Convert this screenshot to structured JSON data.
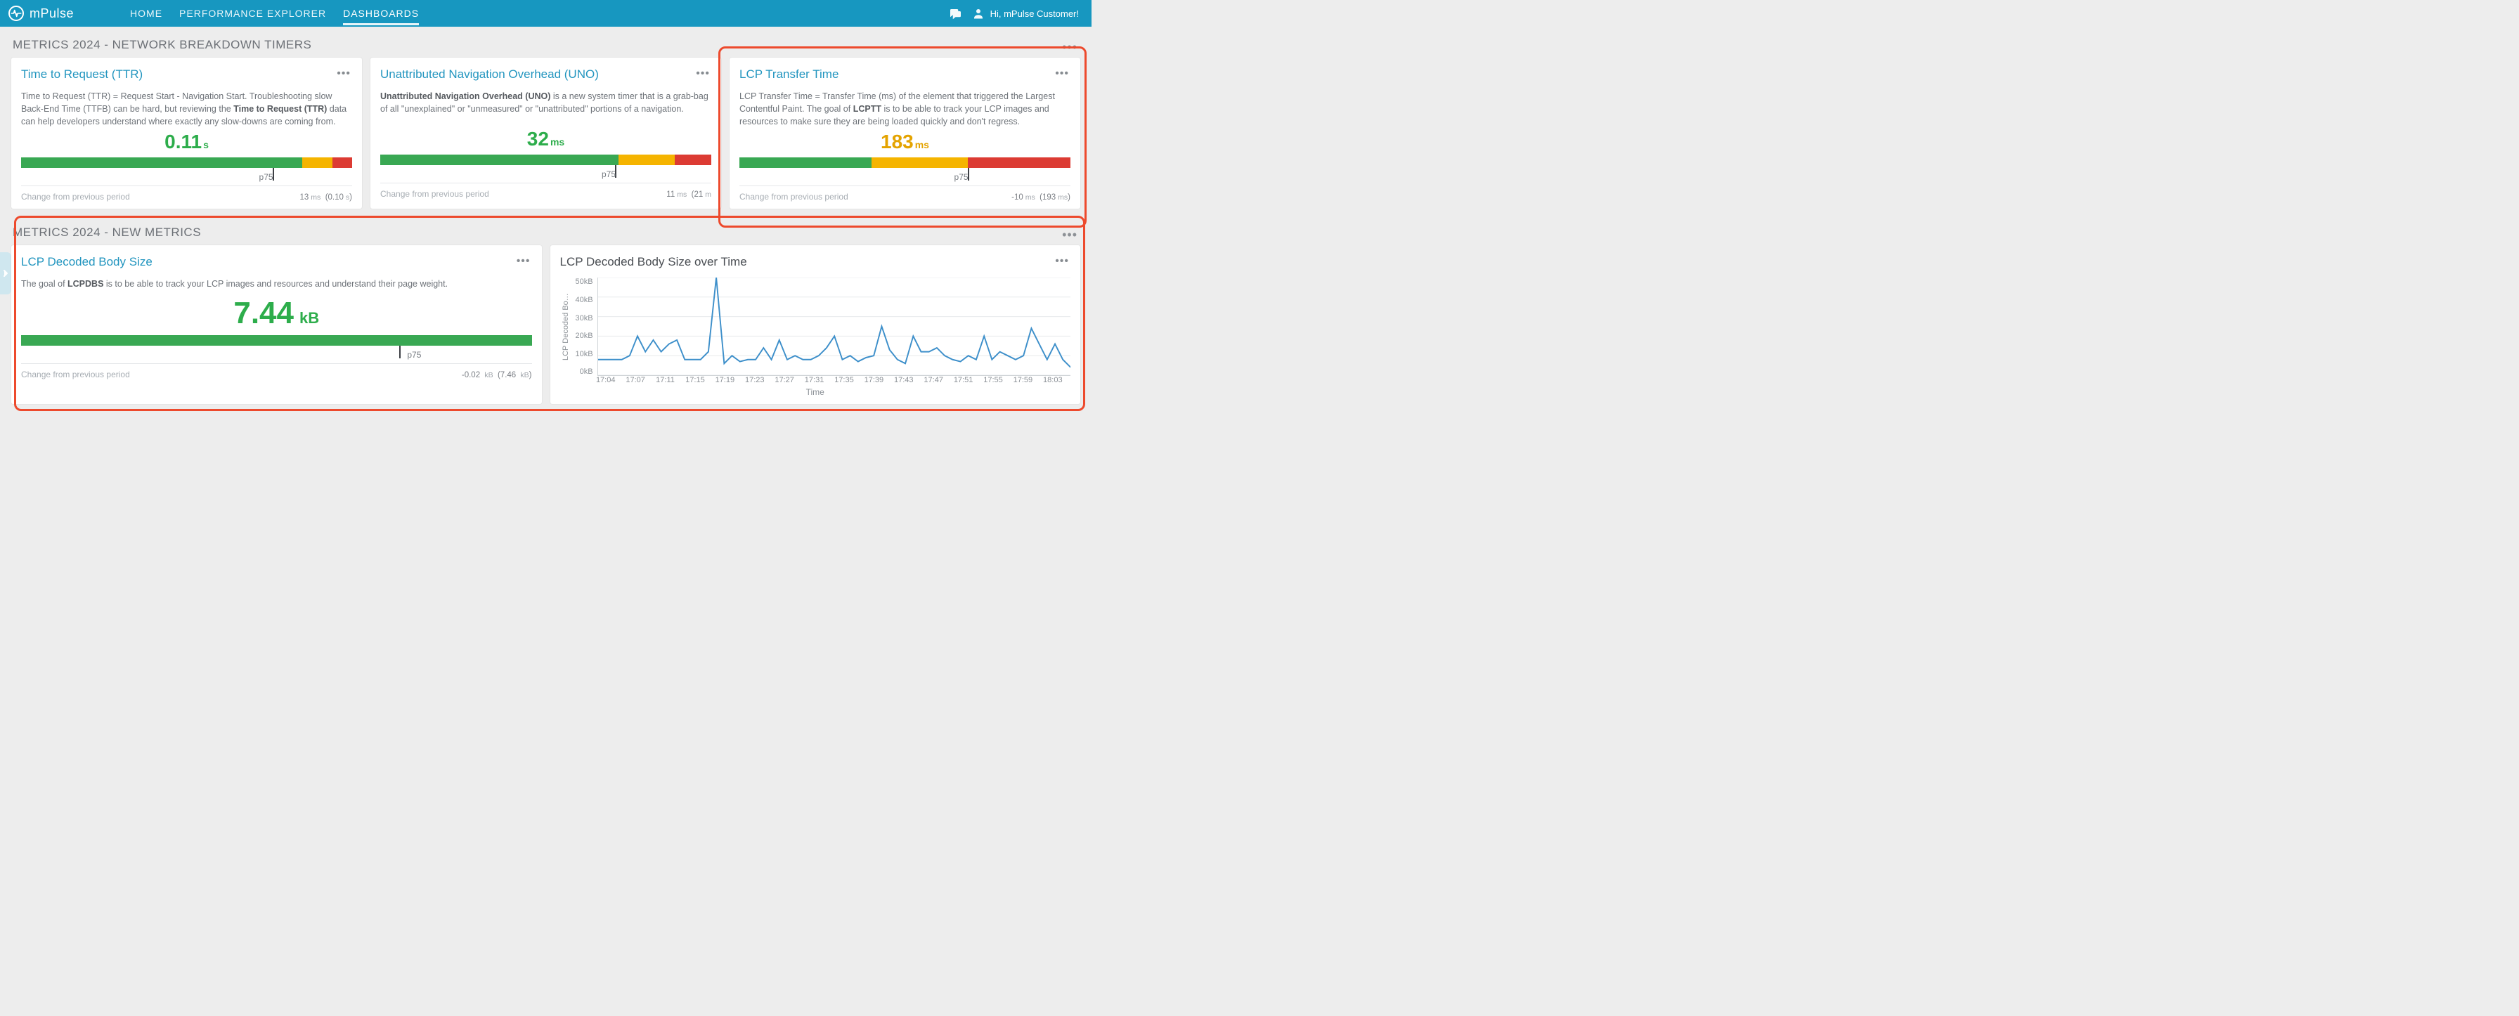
{
  "header": {
    "app_name": "mPulse",
    "nav": {
      "home": "HOME",
      "perf": "PERFORMANCE EXPLORER",
      "dash": "DASHBOARDS"
    },
    "greeting": "Hi, mPulse Customer!"
  },
  "section1": {
    "title": "METRICS 2024 - NETWORK BREAKDOWN TIMERS",
    "cards": [
      {
        "title": "Time to Request (TTR)",
        "desc_prefix": "Time to Request (TTR) = Request Start - Navigation Start. Troubleshooting slow Back-End Time (TTFB) can be hard, but reviewing the ",
        "desc_bold": "Time to Request (TTR)",
        "desc_suffix": " data can help developers understand where exactly any slow-downs are coming from.",
        "value": "0.11",
        "unit": "s",
        "tone": "green",
        "bar": {
          "g": 85,
          "a": 9,
          "r": 6
        },
        "p75_mark_pct": 76,
        "p75_label_pct": 74,
        "p75_label": "p75",
        "change_label": "Change from previous period",
        "change_value": "13",
        "change_unit": "ms",
        "change_extra": "(0.10",
        "change_extra_unit": "s",
        "change_close": ")"
      },
      {
        "title": "Unattributed Navigation Overhead (UNO)",
        "desc_bold": "Unattributed Navigation Overhead (UNO)",
        "desc_suffix": " is a new system timer that is a grab-bag of all \"unexplained\" or \"unmeasured\" or \"unattributed\" portions of a navigation.",
        "value": "32",
        "unit": "ms",
        "tone": "green",
        "bar": {
          "g": 72,
          "a": 17,
          "r": 11
        },
        "p75_mark_pct": 71,
        "p75_label_pct": 69,
        "p75_label": "p75",
        "change_label": "Change from previous period",
        "change_value": "11",
        "change_unit": "ms",
        "change_extra": "(21",
        "change_extra_unit": "m",
        "change_close": ""
      },
      {
        "title": "LCP Transfer Time",
        "desc_prefix": "LCP Transfer Time = Transfer Time (ms) of the element that triggered the Largest Contentful Paint. The goal of ",
        "desc_bold": "LCPTT",
        "desc_suffix": " is to be able to track your LCP images and resources to make sure they are being loaded quickly and don't regress.",
        "value": "183",
        "unit": "ms",
        "tone": "amber",
        "bar": {
          "g": 40,
          "a": 29,
          "r": 31
        },
        "p75_mark_pct": 69,
        "p75_label_pct": 67,
        "p75_label": "p75",
        "change_label": "Change from previous period",
        "change_value": "-10",
        "change_unit": "ms",
        "change_extra": "(193",
        "change_extra_unit": "ms",
        "change_close": ")"
      }
    ]
  },
  "section2": {
    "title": "METRICS 2024 - NEW METRICS",
    "card_left": {
      "title": "LCP Decoded Body Size",
      "desc_prefix": "The goal of ",
      "desc_bold": "LCPDBS",
      "desc_suffix": " is to be able to track your LCP images and resources and understand their page weight.",
      "value": "7.44",
      "unit": "kB",
      "p75_mark_pct": 74,
      "p75_label_pct": 77,
      "p75_label": "p75",
      "change_label": "Change from previous period",
      "change_value": "-0.02",
      "change_unit": "kB",
      "change_extra": "(7.46",
      "change_extra_unit": "kB",
      "change_close": ")"
    },
    "card_right": {
      "title": "LCP Decoded Body Size over Time",
      "ylabel": "LCP Decoded Bo…",
      "xlabel": "Time"
    }
  },
  "chart_data": {
    "type": "line",
    "title": "LCP Decoded Body Size over Time",
    "xlabel": "Time",
    "ylabel": "LCP Decoded Body Size",
    "ylim": [
      0,
      50
    ],
    "y_ticks": [
      "50kB",
      "40kB",
      "30kB",
      "20kB",
      "10kB",
      "0kB"
    ],
    "x_ticks": [
      "17:04",
      "17:07",
      "17:11",
      "17:15",
      "17:19",
      "17:23",
      "17:27",
      "17:31",
      "17:35",
      "17:39",
      "17:43",
      "17:47",
      "17:51",
      "17:55",
      "17:59",
      "18:03"
    ],
    "x": [
      "17:03",
      "17:04",
      "17:05",
      "17:06",
      "17:07",
      "17:08",
      "17:09",
      "17:10",
      "17:11",
      "17:12",
      "17:13",
      "17:14",
      "17:15",
      "17:16",
      "17:17",
      "17:18",
      "17:19",
      "17:20",
      "17:21",
      "17:22",
      "17:23",
      "17:24",
      "17:25",
      "17:26",
      "17:27",
      "17:28",
      "17:29",
      "17:30",
      "17:31",
      "17:32",
      "17:33",
      "17:34",
      "17:35",
      "17:36",
      "17:37",
      "17:38",
      "17:39",
      "17:40",
      "17:41",
      "17:42",
      "17:43",
      "17:44",
      "17:45",
      "17:46",
      "17:47",
      "17:48",
      "17:49",
      "17:50",
      "17:51",
      "17:52",
      "17:53",
      "17:54",
      "17:55",
      "17:56",
      "17:57",
      "17:58",
      "17:59",
      "18:00",
      "18:01",
      "18:02",
      "18:03"
    ],
    "values": [
      8,
      8,
      8,
      8,
      10,
      20,
      12,
      18,
      12,
      16,
      18,
      8,
      8,
      8,
      12,
      50,
      6,
      10,
      7,
      8,
      8,
      14,
      8,
      18,
      8,
      10,
      8,
      8,
      10,
      14,
      20,
      8,
      10,
      7,
      9,
      10,
      25,
      13,
      8,
      6,
      20,
      12,
      12,
      14,
      10,
      8,
      7,
      10,
      8,
      20,
      8,
      12,
      10,
      8,
      10,
      24,
      16,
      8,
      16,
      8,
      4
    ]
  }
}
